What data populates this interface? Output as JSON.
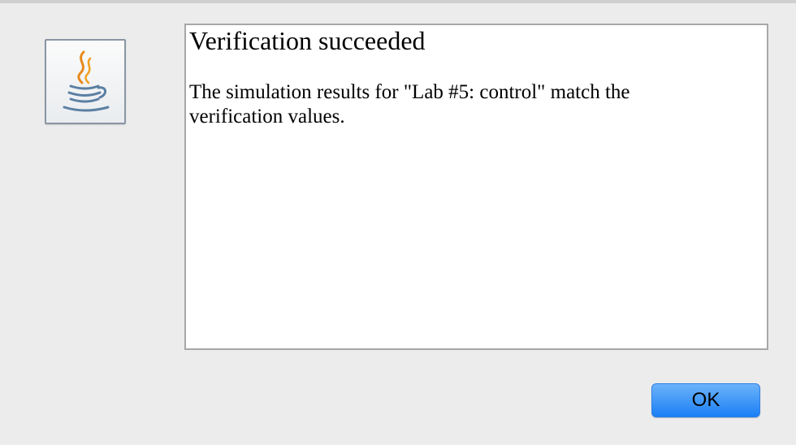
{
  "dialog": {
    "title": "Verification succeeded",
    "message": "The simulation results for \"Lab #5: control\" match the\nverification values.",
    "ok_label": "OK",
    "icon": "java-coffee-cup-icon",
    "accent_color": "#1a7ff5"
  }
}
